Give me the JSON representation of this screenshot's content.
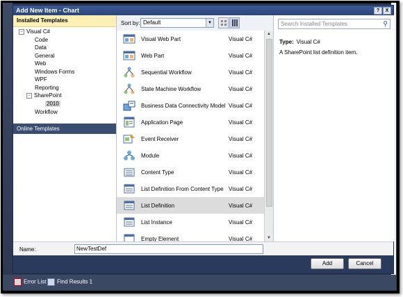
{
  "dialog": {
    "title": "Add New Item - Chart",
    "help_btn": "?",
    "close_btn": "X"
  },
  "left_pane": {
    "header": "Installed Templates",
    "tree": [
      {
        "label": "Visual C#",
        "expander": "−"
      },
      {
        "label": "Code"
      },
      {
        "label": "Data"
      },
      {
        "label": "General"
      },
      {
        "label": "Web"
      },
      {
        "label": "Windows Forms"
      },
      {
        "label": "WPF"
      },
      {
        "label": "Reporting"
      },
      {
        "label": "SharePoint",
        "expander": "−"
      },
      {
        "label": "2010"
      },
      {
        "label": "Workflow"
      }
    ],
    "online": "Online Templates"
  },
  "toolbar": {
    "sort_label": "Sort by:",
    "sort_value": "Default"
  },
  "search": {
    "placeholder": "Search Installed Templates"
  },
  "templates": [
    {
      "name": "Visual Web Part",
      "lang": "Visual C#",
      "icon": "web-part-icon"
    },
    {
      "name": "Web Part",
      "lang": "Visual C#",
      "icon": "web-part-icon"
    },
    {
      "name": "Sequential Workflow",
      "lang": "Visual C#",
      "icon": "workflow-icon"
    },
    {
      "name": "State Machine Workflow",
      "lang": "Visual C#",
      "icon": "workflow-icon"
    },
    {
      "name": "Business Data Connectivity Model",
      "lang": "Visual C#",
      "icon": "bdc-model-icon"
    },
    {
      "name": "Application Page",
      "lang": "Visual C#",
      "icon": "page-icon"
    },
    {
      "name": "Event Receiver",
      "lang": "Visual C#",
      "icon": "event-receiver-icon"
    },
    {
      "name": "Module",
      "lang": "Visual C#",
      "icon": "module-icon"
    },
    {
      "name": "Content Type",
      "lang": "Visual C#",
      "icon": "content-type-icon"
    },
    {
      "name": "List Definition From Content Type",
      "lang": "Visual C#",
      "icon": "list-icon"
    },
    {
      "name": "List Definition",
      "lang": "Visual C#",
      "icon": "list-icon",
      "selected": true
    },
    {
      "name": "List Instance",
      "lang": "Visual C#",
      "icon": "list-icon"
    },
    {
      "name": "Empty Element",
      "lang": "Visual C#",
      "icon": "element-icon"
    }
  ],
  "details": {
    "type_label": "Type:",
    "type_value": "Visual C#",
    "description": "A SharePoint list definition item."
  },
  "name_field": {
    "label": "Name:",
    "value": "NewTestDef"
  },
  "buttons": {
    "add": "Add",
    "cancel": "Cancel"
  },
  "statusbar": {
    "error_list": "Error List",
    "find_results": "Find Results 1"
  },
  "colors": {
    "title_bar": "#2b4579",
    "header_highlight": "#fef0b4",
    "online_bg": "#3a4e72",
    "selected_row": "#dcdcdc"
  }
}
